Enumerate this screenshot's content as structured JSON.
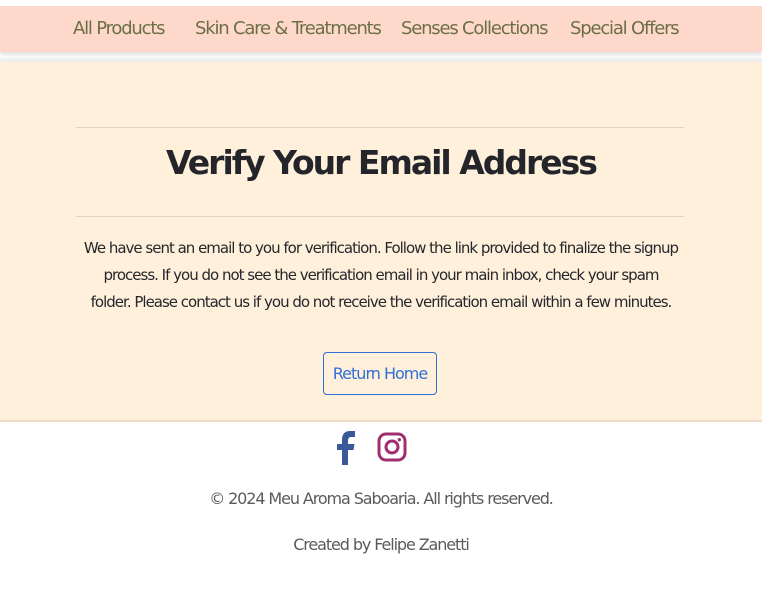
{
  "nav": {
    "items": [
      {
        "label": "All Products"
      },
      {
        "label": "Skin Care & Treatments"
      },
      {
        "label": "Senses Collections"
      },
      {
        "label": "Special Offers"
      }
    ]
  },
  "main": {
    "title": "Verify Your Email Address",
    "message": "We have sent an email to you for verification. Follow the link provided to finalize the signup process. If you do not see the verification email in your main inbox, check your spam folder. Please contact us if you do not receive the verification email within a few minutes.",
    "button_label": "Return Home"
  },
  "footer": {
    "social": [
      {
        "icon": "facebook-icon",
        "color": "#3b5998"
      },
      {
        "icon": "instagram-icon",
        "color": "#a02f6f"
      }
    ],
    "copyright": "© 2024 Meu Aroma Saboaria. All rights reserved.",
    "credit": "Created by Felipe Zanetti"
  },
  "colors": {
    "nav_bg": "#ffd8cc",
    "nav_text": "#6b6f45",
    "main_bg": "#fff0dc",
    "accent": "#2f6fd6"
  }
}
